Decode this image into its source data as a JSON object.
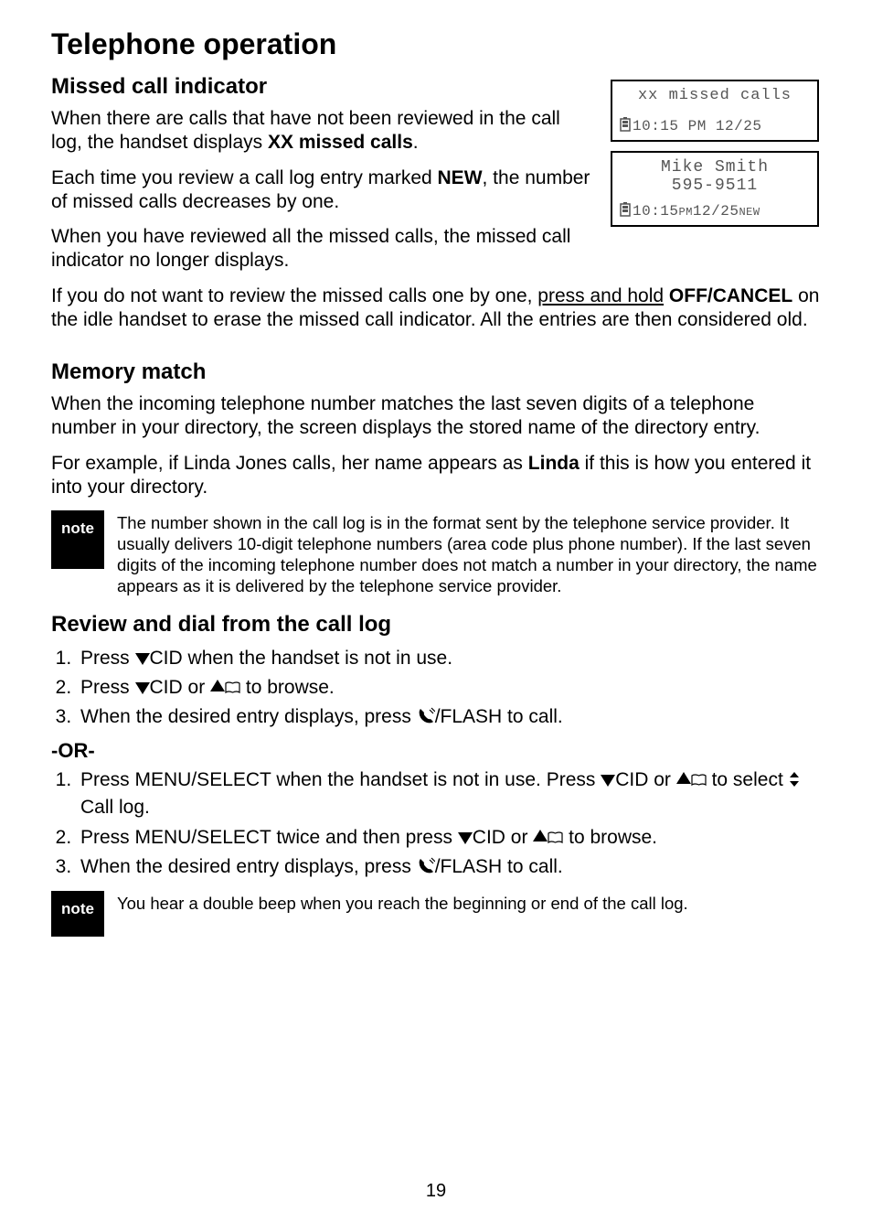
{
  "page_title": "Telephone operation",
  "page_number": "19",
  "sections": {
    "missed": {
      "heading": "Missed call indicator",
      "p1_a": "When there are calls that have not been reviewed in the call log, the handset displays ",
      "p1_bold": "XX missed calls",
      "p1_b": ".",
      "p2_a": "Each time you review a call log entry marked ",
      "p2_bold": "NEW",
      "p2_b": ", the number of missed calls decreases by one.",
      "p3": "When you have reviewed all the missed calls, the missed call indicator no longer displays.",
      "p4_a": "If you do not want to review the missed calls one by one, ",
      "p4_u": "press and hold",
      "p4_b": " ",
      "p4_key": "OFF/CANCEL",
      "p4_c": " on the idle handset to erase the missed call indicator. All the entries are then considered old."
    },
    "memory": {
      "heading": "Memory match",
      "p1": "When the incoming telephone number matches the last seven digits of a telephone number in your directory, the screen displays the stored name of the directory entry.",
      "p2_a": "For example, if Linda Jones calls, her name appears as ",
      "p2_bold": "Linda",
      "p2_b": " if this is how you entered it into your directory.",
      "note": "The number shown in the call log is in the format sent by the telephone service provider. It usually delivers 10-digit telephone numbers (area code plus phone number). If the last seven digits of the incoming telephone number does not match a number in your directory, the name appears as it is delivered by the telephone service provider."
    },
    "review": {
      "heading": "Review and dial from the call log",
      "or": "-OR-",
      "steps1": {
        "s1_a": "Press ",
        "s1_cid": "CID",
        "s1_b": " when the handset is not in use.",
        "s2_a": "Press ",
        "s2_cid": "CID",
        "s2_b": " or ",
        "s2_c": " to browse.",
        "s3_a": "When the desired entry displays, press ",
        "s3_flash": "/FLASH",
        "s3_b": " to call."
      },
      "steps2": {
        "s1_a": "Press ",
        "s1_menu": "MENU/SELECT",
        "s1_b": " when the handset is not in use. Press ",
        "s1_cid": "CID",
        "s1_c": " or ",
        "s1_d": " to select ",
        "s1_calllog": "Call log.",
        "s2_a": "Press ",
        "s2_menu": "MENU/SELECT",
        "s2_b": " twice and then press ",
        "s2_cid": "CID",
        "s2_c": " or ",
        "s2_d": " to browse.",
        "s3_a": "When the desired entry displays, press ",
        "s3_flash": "/FLASH",
        "s3_b": " to call."
      },
      "note": "You hear a double beep when you reach the beginning or end of the call log."
    }
  },
  "note_label": "note",
  "screens": {
    "top": {
      "line1": "xx missed calls",
      "line2": "10:15 PM 12/25"
    },
    "bottom": {
      "name": "Mike Smith",
      "number": "595-9511",
      "line2_a": "10:15",
      "line2_pm": "PM",
      "line2_b": "12/25",
      "line2_new": "NEW"
    }
  }
}
